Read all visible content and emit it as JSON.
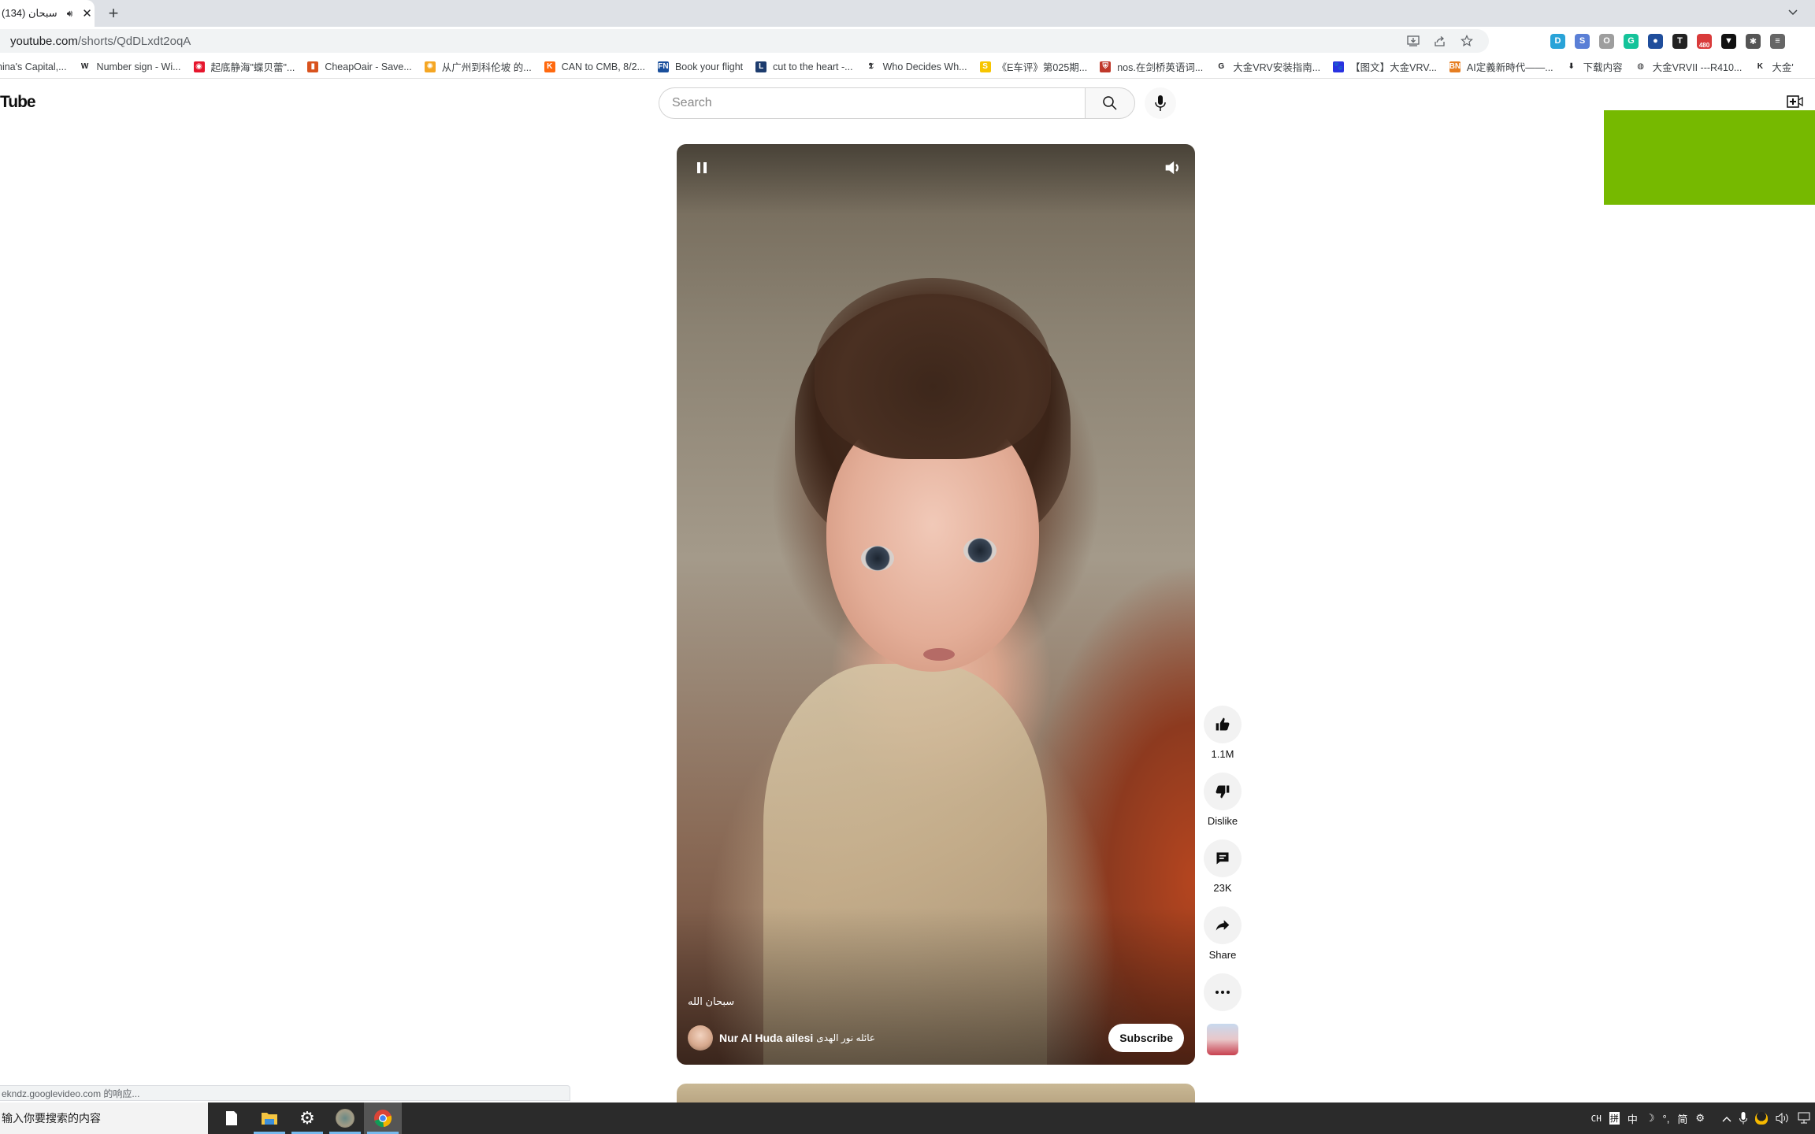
{
  "browser": {
    "tab": {
      "title": "سبحان (134)",
      "audio_icon": "speaker-icon",
      "close_icon": "close-icon"
    },
    "new_tab_icon": "plus-icon",
    "tab_search_icon": "chevron-down-icon",
    "address": {
      "host": "youtube.com",
      "path": "/shorts/QdDLxdt2oqA"
    },
    "omnibox_icons": [
      "install-icon",
      "share-icon",
      "star-icon"
    ],
    "extensions": [
      {
        "name": "dict-extension-icon",
        "label": "D",
        "color": "#29a3d8"
      },
      {
        "name": "translate-extension-icon",
        "label": "S",
        "color": "#5a7fd6"
      },
      {
        "name": "office-extension-icon",
        "label": "O",
        "color": "#9e9e9e"
      },
      {
        "name": "grammarly-extension-icon",
        "label": "G",
        "color": "#15c39a"
      },
      {
        "name": "globe-extension-icon",
        "label": "●",
        "color": "#1f4e9c"
      },
      {
        "name": "telescope-extension-icon",
        "label": "T",
        "color": "#222222"
      },
      {
        "name": "mail-extension-icon",
        "label": "480",
        "color": "#d93b3b"
      },
      {
        "name": "vpn-extension-icon",
        "label": "▼",
        "color": "#111111"
      },
      {
        "name": "puzzle-extension-icon",
        "label": "✱",
        "color": "#555555"
      },
      {
        "name": "media-control-icon",
        "label": "≡",
        "color": "#666666"
      }
    ],
    "bookmarks": [
      {
        "label": "hina's Capital,...",
        "icon": "bookmark-page-icon",
        "color": "#ffffff",
        "glyph": ""
      },
      {
        "label": "Number sign - Wi...",
        "icon": "wikipedia-icon",
        "color": "#ffffff",
        "glyph": "W"
      },
      {
        "label": "起底静海\"蝶贝蕾\"...",
        "icon": "weibo-icon",
        "color": "#e6162d",
        "glyph": "◉"
      },
      {
        "label": "CheapOair - Save...",
        "icon": "cheapoair-icon",
        "color": "#d9531e",
        "glyph": "▮"
      },
      {
        "label": "从广州到科伦坡 的...",
        "icon": "flower-icon",
        "color": "#f5a623",
        "glyph": "✺"
      },
      {
        "label": "CAN to CMB, 8/2...",
        "icon": "kayak-icon",
        "color": "#ff690f",
        "glyph": "K"
      },
      {
        "label": "Book your flight",
        "icon": "fn-icon",
        "color": "#1a4f9c",
        "glyph": "FN"
      },
      {
        "label": "cut to the heart -...",
        "icon": "dictionary-icon",
        "color": "#1d3c6e",
        "glyph": "L"
      },
      {
        "label": "Who Decides Wh...",
        "icon": "nytimes-icon",
        "color": "#ffffff",
        "glyph": "𝕿"
      },
      {
        "label": "《E车评》第025期...",
        "icon": "sohu-icon",
        "color": "#f7c500",
        "glyph": "S"
      },
      {
        "label": "nos.在剑桥英语词...",
        "icon": "cambridge-icon",
        "color": "#c0392b",
        "glyph": "⛨"
      },
      {
        "label": "大金VRV安装指南...",
        "icon": "google-icon",
        "color": "#ffffff",
        "glyph": "G"
      },
      {
        "label": "【图文】大金VRV...",
        "icon": "baidu-icon",
        "color": "#2932e1",
        "glyph": "🐾"
      },
      {
        "label": "AI定義新時代——...",
        "icon": "bn-icon",
        "color": "#e67e22",
        "glyph": "BN"
      },
      {
        "label": "下载内容",
        "icon": "download-icon",
        "color": "#ffffff",
        "glyph": "⬇"
      },
      {
        "label": "大金VRVII ---R410...",
        "icon": "globe-icon",
        "color": "#ffffff",
        "glyph": "◍"
      },
      {
        "label": "大金'",
        "icon": "k-icon",
        "color": "#ffffff",
        "glyph": "K"
      }
    ]
  },
  "youtube": {
    "logo_text": "Tube",
    "search": {
      "placeholder": "Search",
      "value": ""
    },
    "search_icon": "search-icon",
    "mic_icon": "microphone-icon",
    "create_icon": "create-video-icon",
    "ad_color": "#76b900",
    "short": {
      "caption": "سبحان الله",
      "channel_name": "Nur Al Huda ailesi",
      "channel_name_arabic": "عائله نور الهدى",
      "subscribe_label": "Subscribe",
      "pause_icon": "pause-icon",
      "volume_icon": "volume-icon"
    },
    "actions": [
      {
        "name": "like-button",
        "icon": "thumbs-up-icon",
        "label": "1.1M"
      },
      {
        "name": "dislike-button",
        "icon": "thumbs-down-icon",
        "label": "Dislike"
      },
      {
        "name": "comments-button",
        "icon": "comment-icon",
        "label": "23K"
      },
      {
        "name": "share-button",
        "icon": "share-arrow-icon",
        "label": "Share"
      },
      {
        "name": "more-button",
        "icon": "more-horizontal-icon",
        "label": ""
      }
    ]
  },
  "status_bubble": "ekndz.googlevideo.com 的响应...",
  "taskbar": {
    "search_placeholder": "输入你要搜索的内容",
    "apps": [
      {
        "name": "notepad-app",
        "icon": "file-icon"
      },
      {
        "name": "file-explorer-app",
        "icon": "folder-icon"
      },
      {
        "name": "settings-app",
        "icon": "gear-icon"
      },
      {
        "name": "photo-app",
        "icon": "photo-icon"
      },
      {
        "name": "chrome-app",
        "icon": "chrome-icon"
      }
    ],
    "tray": {
      "lang": "CH",
      "ime_mode": "拼",
      "ime_zh": "中",
      "ime_moon": "☽",
      "ime_punct": "°,",
      "ime_simplified": "简",
      "ime_settings": "⚙",
      "chevron": "^",
      "items": [
        "microphone-tray-icon",
        "qq-tray-icon",
        "volume-tray-icon",
        "network-tray-icon"
      ]
    }
  }
}
